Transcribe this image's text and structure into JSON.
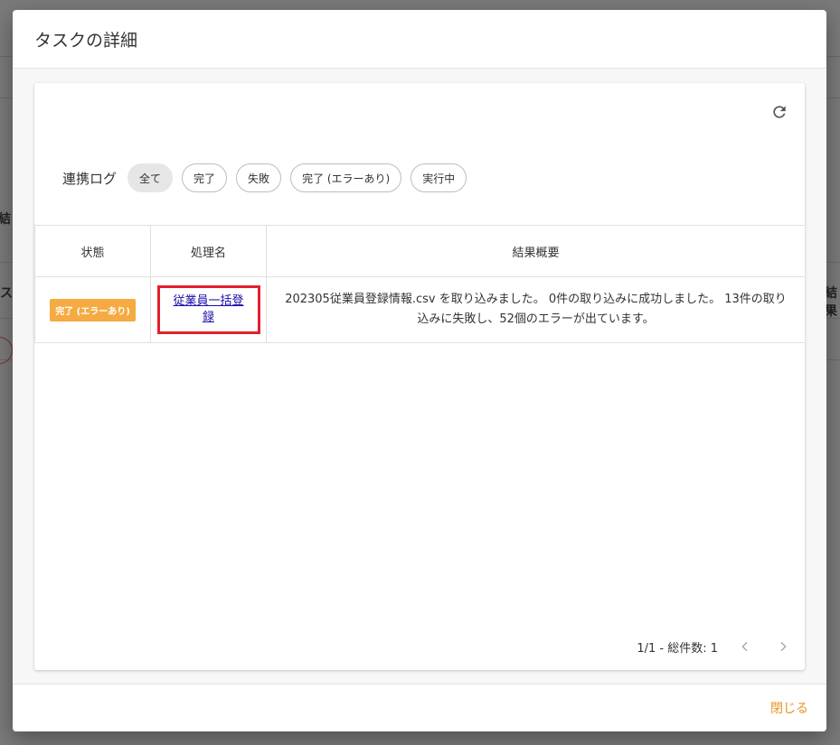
{
  "background": {
    "left_fragment_1": "結",
    "left_fragment_2": "タス",
    "right_fragment": "結果"
  },
  "modal": {
    "title": "タスクの詳細",
    "filter": {
      "label": "連携ログ",
      "chips": [
        "全て",
        "完了",
        "失敗",
        "完了 (エラーあり)",
        "実行中"
      ],
      "active": "全て"
    },
    "table": {
      "headers": [
        "状態",
        "処理名",
        "結果概要"
      ],
      "rows": [
        {
          "status": "完了 (エラーあり)",
          "name": "従業員一括登録",
          "summary": "202305従業員登録情報.csv を取り込みました。 0件の取り込みに成功しました。 13件の取り込みに失敗し、52個のエラーが出ています。"
        }
      ]
    },
    "pagination": {
      "text": "1/1 - 総件数: 1"
    },
    "footer": {
      "close_label": "閉じる"
    }
  },
  "colors": {
    "status_badge": "#f5ab41",
    "highlight_box": "#e3202b",
    "close_button": "#e8931f",
    "link": "#1a0dab"
  },
  "icons": {
    "refresh": "refresh-icon",
    "prev": "chevron-left-icon",
    "next": "chevron-right-icon"
  }
}
